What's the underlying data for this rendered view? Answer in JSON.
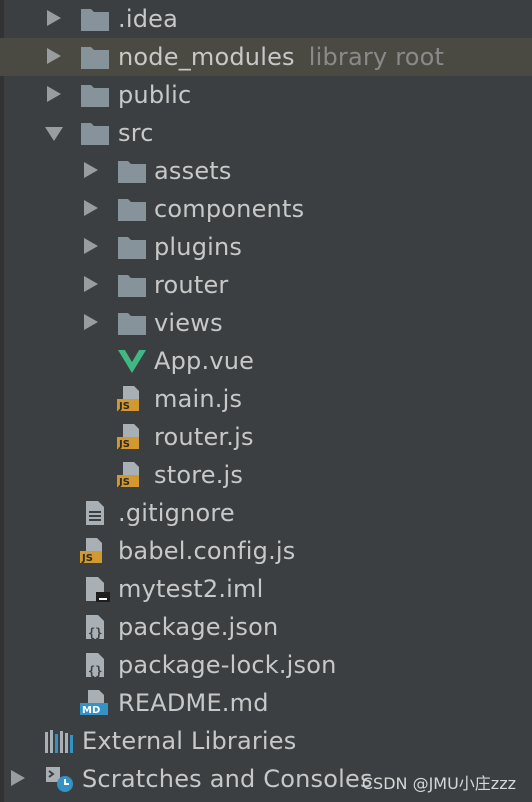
{
  "tree": {
    "idea": ".idea",
    "node_modules": "node_modules",
    "node_modules_hint": "library root",
    "public": "public",
    "src": "src",
    "assets": "assets",
    "components": "components",
    "plugins": "plugins",
    "router": "router",
    "views": "views",
    "app_vue": "App.vue",
    "main_js": "main.js",
    "router_js": "router.js",
    "store_js": "store.js",
    "gitignore": ".gitignore",
    "babel_config": "babel.config.js",
    "mytest2": "mytest2.iml",
    "package_json": "package.json",
    "package_lock": "package-lock.json",
    "readme": "README.md",
    "external_libraries": "External Libraries",
    "scratches": "Scratches and Consoles"
  },
  "badges": {
    "js": "JS",
    "md": "MD"
  },
  "watermark": "CSDN @JMU小庄zzz",
  "colors": {
    "background": "#3c3f41",
    "selected_row": "#4b4a42",
    "folder": "#87939a",
    "vue": "#41b883",
    "js_badge": "#d1992f",
    "md_badge": "#3592c4"
  }
}
